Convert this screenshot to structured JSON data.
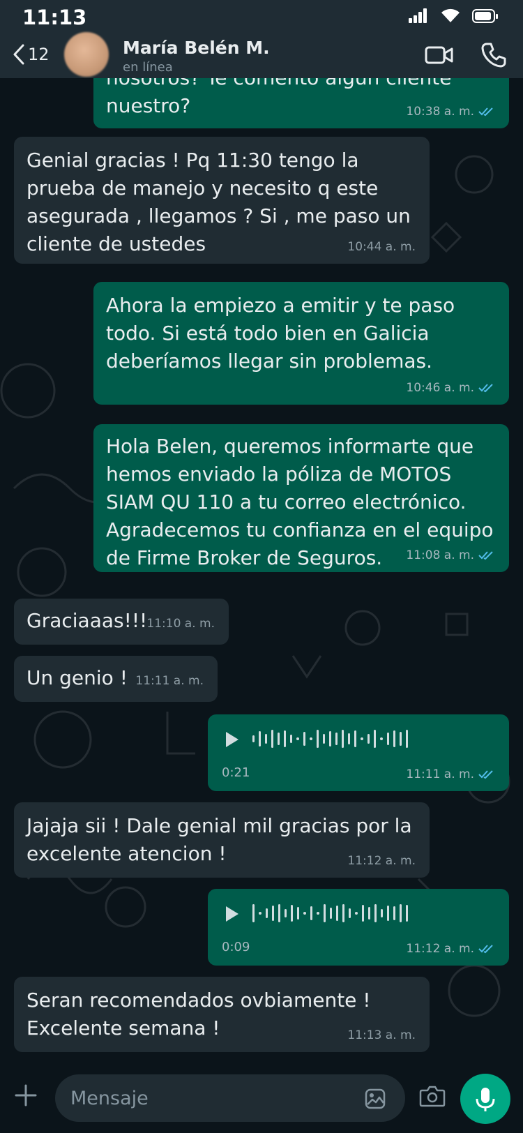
{
  "status_bar": {
    "time": "11:13"
  },
  "header": {
    "back_count": "12",
    "contact_name": "María Belén M.",
    "contact_status": "en línea"
  },
  "messages": [
    {
      "dir": "out",
      "text": "nosotros? Te comento algún cliente\nnuestro?",
      "time": "10:38 a. m.",
      "read": true
    },
    {
      "dir": "in",
      "text": "Genial gracias ! Pq 11:30 tengo la\nprueba de manejo y necesito q este\nasegurada , llegamos ? Si , me paso un\ncliente de ustedes",
      "time": "10:44 a. m."
    },
    {
      "dir": "out",
      "text": "Ahora la empiezo a emitir y te paso\ntodo. Si está todo bien en Galicia\ndeberíamos llegar sin problemas.",
      "time": "10:46 a. m.",
      "read": true
    },
    {
      "dir": "out",
      "text": "Hola Belen, queremos informarte que\nhemos enviado la póliza de MOTOS\nSIAM QU 110 a tu correo electrónico.\nAgradecemos tu confianza en el equipo\nde Firme Broker de Seguros.",
      "time": "11:08 a. m.",
      "read": true
    },
    {
      "dir": "in",
      "text": "Graciaaas!!!",
      "time": "11:10 a. m."
    },
    {
      "dir": "in",
      "text": "Un genio !",
      "time": "11:11 a. m."
    },
    {
      "dir": "out",
      "type": "voice",
      "duration": "0:21",
      "time": "11:11 a. m.",
      "read": true
    },
    {
      "dir": "in",
      "text": "Jajaja sii ! Dale genial mil gracias por la\nexcelente atencion !",
      "time": "11:12 a. m."
    },
    {
      "dir": "out",
      "type": "voice",
      "duration": "0:09",
      "time": "11:12 a. m.",
      "read": true
    },
    {
      "dir": "in",
      "text": "Seran recomendados ovbiamente !\nExcelente semana !",
      "time": "11:13 a. m."
    }
  ],
  "input": {
    "placeholder": "Mensaje"
  },
  "colors": {
    "background": "#0b141a",
    "header": "#1f2c34",
    "incoming_bubble": "#202c33",
    "outgoing_bubble": "#005c4b",
    "read_ticks": "#53bdeb",
    "mic_button": "#00a884"
  },
  "icons": [
    "back-chevron-icon",
    "video-call-icon",
    "phone-icon",
    "play-icon",
    "double-check-icon",
    "plus-icon",
    "sticker-icon",
    "camera-icon",
    "mic-icon"
  ]
}
